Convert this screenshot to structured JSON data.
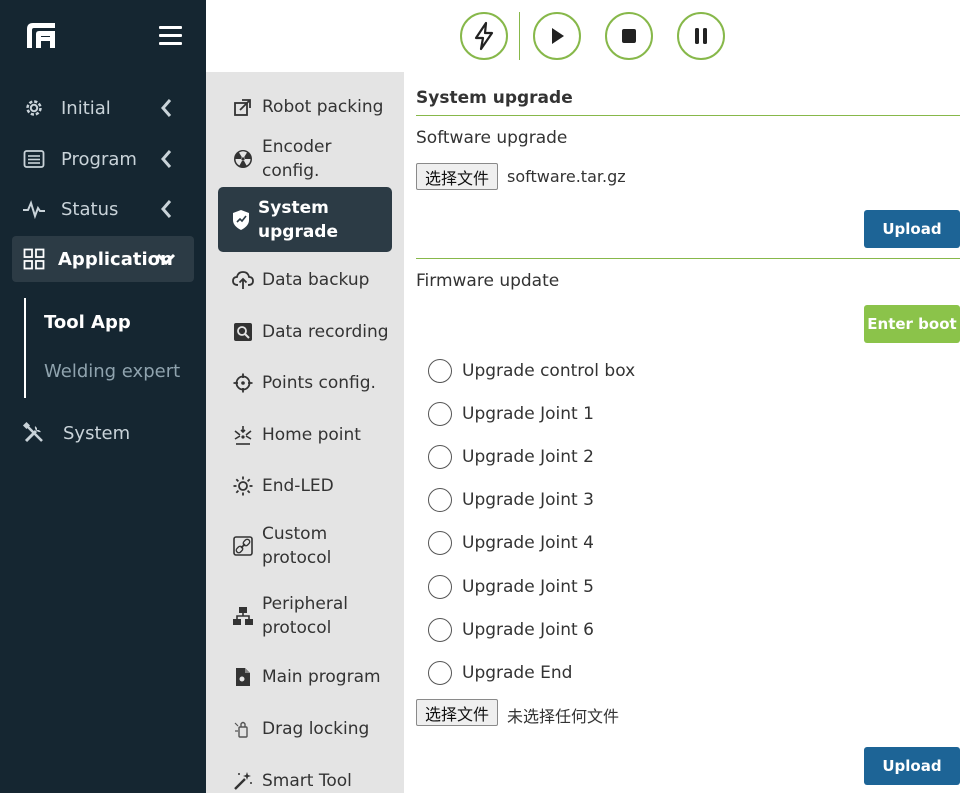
{
  "colors": {
    "sidebar_bg": "#152631",
    "accent_green": "#87b84a",
    "upload_blue": "#1d6496",
    "boot_green": "#8bc34a",
    "active_item_bg": "#2c3b45"
  },
  "sidebar": {
    "logo_icon": "robot-logo-icon",
    "menu_icon": "hamburger-icon",
    "items": [
      {
        "label": "Initial",
        "icon": "gear-icon"
      },
      {
        "label": "Program",
        "icon": "list-icon"
      },
      {
        "label": "Status",
        "icon": "pulse-icon"
      },
      {
        "label": "Application",
        "icon": "grid-icon",
        "active": true
      },
      {
        "label": "System",
        "icon": "tools-icon"
      }
    ],
    "sub_items": [
      {
        "label": "Tool App",
        "active": true
      },
      {
        "label": "Welding expert"
      }
    ]
  },
  "toolbar": {
    "buttons": [
      {
        "name": "enable",
        "icon": "lightning-icon"
      },
      {
        "name": "play",
        "icon": "play-icon"
      },
      {
        "name": "stop",
        "icon": "stop-icon"
      },
      {
        "name": "pause",
        "icon": "pause-icon"
      }
    ]
  },
  "menu": {
    "items": [
      {
        "label": "Robot packing",
        "icon": "packing-icon"
      },
      {
        "label": "Encoder config.",
        "icon": "radiation-icon"
      },
      {
        "label": "System upgrade",
        "icon": "shield-icon",
        "active": true
      },
      {
        "label": "Data backup",
        "icon": "cloud-upload-icon"
      },
      {
        "label": "Data recording",
        "icon": "search-icon"
      },
      {
        "label": "Points config.",
        "icon": "crosshair-icon"
      },
      {
        "label": "Home point",
        "icon": "home-point-icon"
      },
      {
        "label": "End-LED",
        "icon": "sun-icon"
      },
      {
        "label": "Custom protocol",
        "icon": "link-icon"
      },
      {
        "label": "Peripheral protocol",
        "icon": "network-icon"
      },
      {
        "label": "Main program",
        "icon": "file-icon"
      },
      {
        "label": "Drag locking",
        "icon": "drag-lock-icon"
      },
      {
        "label": "Smart Tool",
        "icon": "magic-wand-icon"
      }
    ]
  },
  "content": {
    "title": "System upgrade",
    "software": {
      "title": "Software upgrade",
      "choose_file": "选择文件",
      "file_name": "software.tar.gz",
      "upload": "Upload"
    },
    "firmware": {
      "title": "Firmware update",
      "enter_boot": "Enter boot",
      "options": [
        "Upgrade control box",
        "Upgrade Joint 1",
        "Upgrade Joint 2",
        "Upgrade Joint 3",
        "Upgrade Joint 4",
        "Upgrade Joint 5",
        "Upgrade Joint 6",
        "Upgrade End"
      ],
      "choose_file": "选择文件",
      "file_name": "未选择任何文件",
      "upload": "Upload"
    }
  }
}
